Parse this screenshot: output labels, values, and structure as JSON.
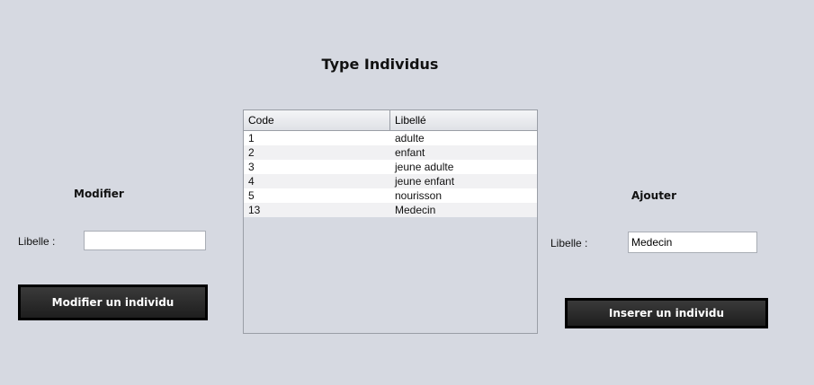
{
  "title": "Type Individus",
  "modify": {
    "heading": "Modifier",
    "label": "Libelle :",
    "value": "",
    "button": "Modifier un individu"
  },
  "add": {
    "heading": "Ajouter",
    "label": "Libelle :",
    "value": "Medecin",
    "button": "Inserer un individu"
  },
  "table": {
    "columns": [
      "Code",
      "Libellé"
    ],
    "rows": [
      [
        "1",
        "adulte"
      ],
      [
        "2",
        "enfant"
      ],
      [
        "3",
        "jeune adulte"
      ],
      [
        "4",
        "jeune enfant"
      ],
      [
        "5",
        "nourisson"
      ],
      [
        "13",
        "Medecin"
      ]
    ]
  }
}
